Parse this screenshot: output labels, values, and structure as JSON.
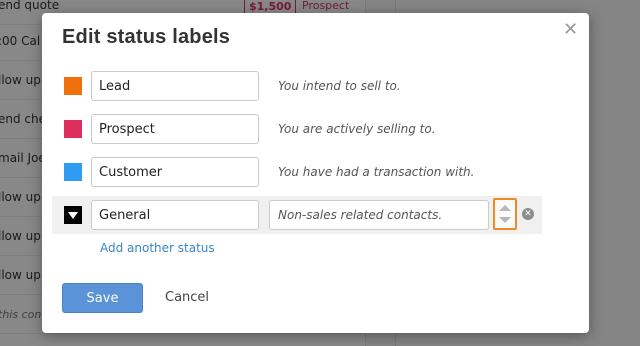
{
  "background": {
    "rows": [
      {
        "text": "end quote",
        "amount": "$1,500",
        "status": "Prospect"
      },
      {
        "text": ":00 Cal"
      },
      {
        "text": "llow up"
      },
      {
        "text": "end che"
      },
      {
        "text": "mail Joe"
      },
      {
        "text": "llow up"
      },
      {
        "text": "llow up"
      },
      {
        "text": "llow up"
      },
      {
        "text": "this con"
      }
    ]
  },
  "dialog": {
    "title": "Edit status labels",
    "close_icon": "close-icon",
    "statuses": [
      {
        "name": "Lead",
        "description": "You intend to sell to.",
        "color": "#f0700e"
      },
      {
        "name": "Prospect",
        "description": "You are actively selling to.",
        "color": "#dc2f5b"
      },
      {
        "name": "Customer",
        "description": "You have had a transaction with.",
        "color": "#2f9bf2"
      }
    ],
    "editing": {
      "name": "General",
      "description": "Non-sales related contacts.",
      "color": "#000000"
    },
    "add_link": "Add another status",
    "save_label": "Save",
    "cancel_label": "Cancel"
  }
}
